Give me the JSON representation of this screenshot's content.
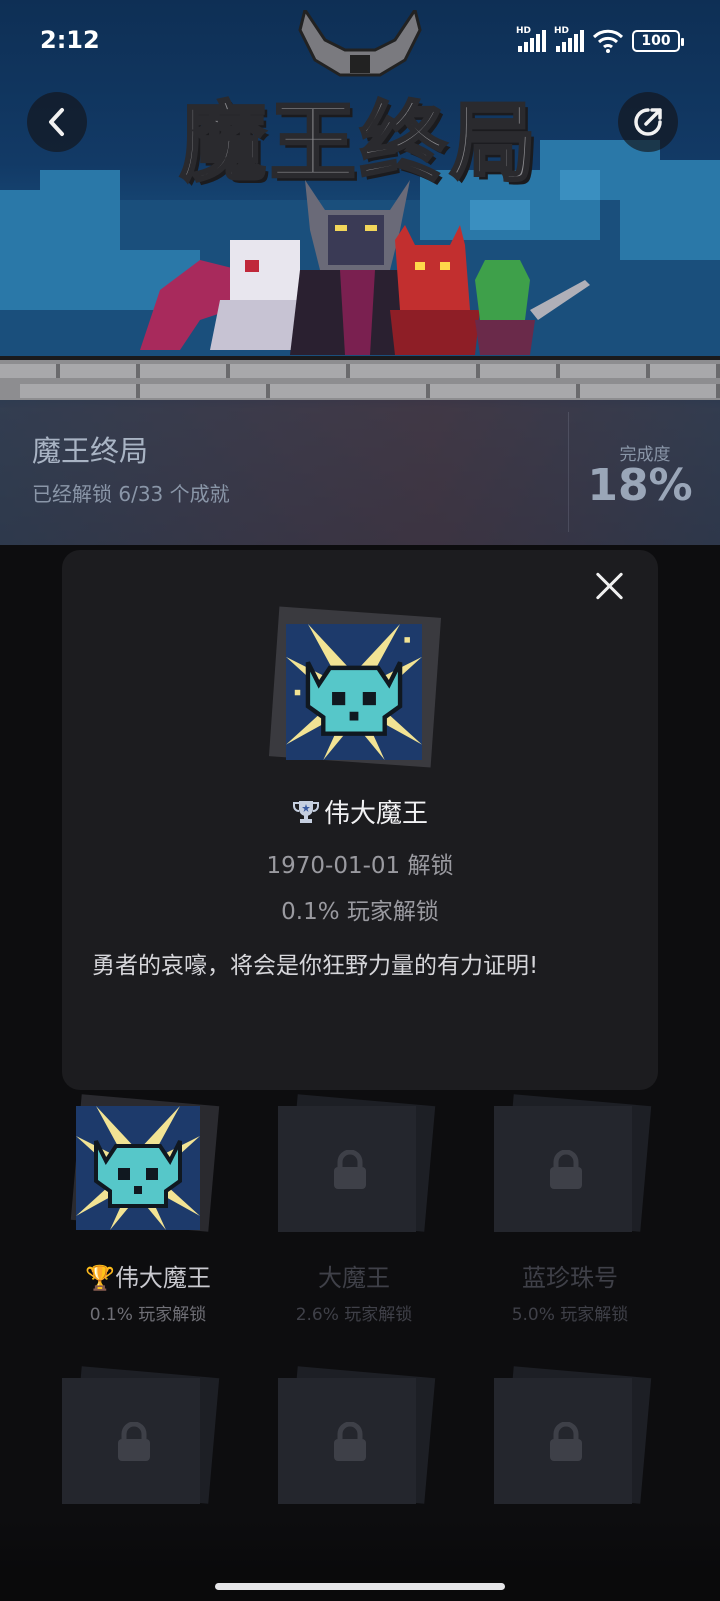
{
  "status_bar": {
    "time": "2:12",
    "network_1": "HD",
    "network_2": "HD",
    "battery": "100"
  },
  "hero": {
    "logo_text": "魔王终局",
    "game_title": "魔王终局",
    "unlocked_summary": "已经解锁 6/33 个成就",
    "progress_label": "完成度",
    "progress_value": "18%"
  },
  "modal": {
    "achievement_name": "伟大魔王",
    "unlock_date": "1970-01-01 解锁",
    "player_percent": "0.1% 玩家解锁",
    "description": "勇者的哀嚎，将会是你狂野力量的有力证明!"
  },
  "grid": {
    "items": [
      {
        "name": "伟大魔王",
        "percent": "0.1% 玩家解锁",
        "unlocked": true
      },
      {
        "name": "大魔王",
        "percent": "2.6% 玩家解锁",
        "unlocked": false
      },
      {
        "name": "蓝珍珠号",
        "percent": "5.0% 玩家解锁",
        "unlocked": false
      },
      {
        "name": "",
        "percent": "",
        "unlocked": false
      },
      {
        "name": "",
        "percent": "",
        "unlocked": false
      },
      {
        "name": "",
        "percent": "",
        "unlocked": false
      }
    ]
  },
  "colors": {
    "accent_badge_bg": "#1d3a6b",
    "skull": "#56c7c9",
    "rays": "#f2e394",
    "card_bg": "#1c1c1f"
  },
  "icons": {
    "back": "chevron-left-icon",
    "share": "share-icon",
    "close": "close-icon",
    "trophy": "trophy-icon",
    "lock": "lock-icon"
  }
}
